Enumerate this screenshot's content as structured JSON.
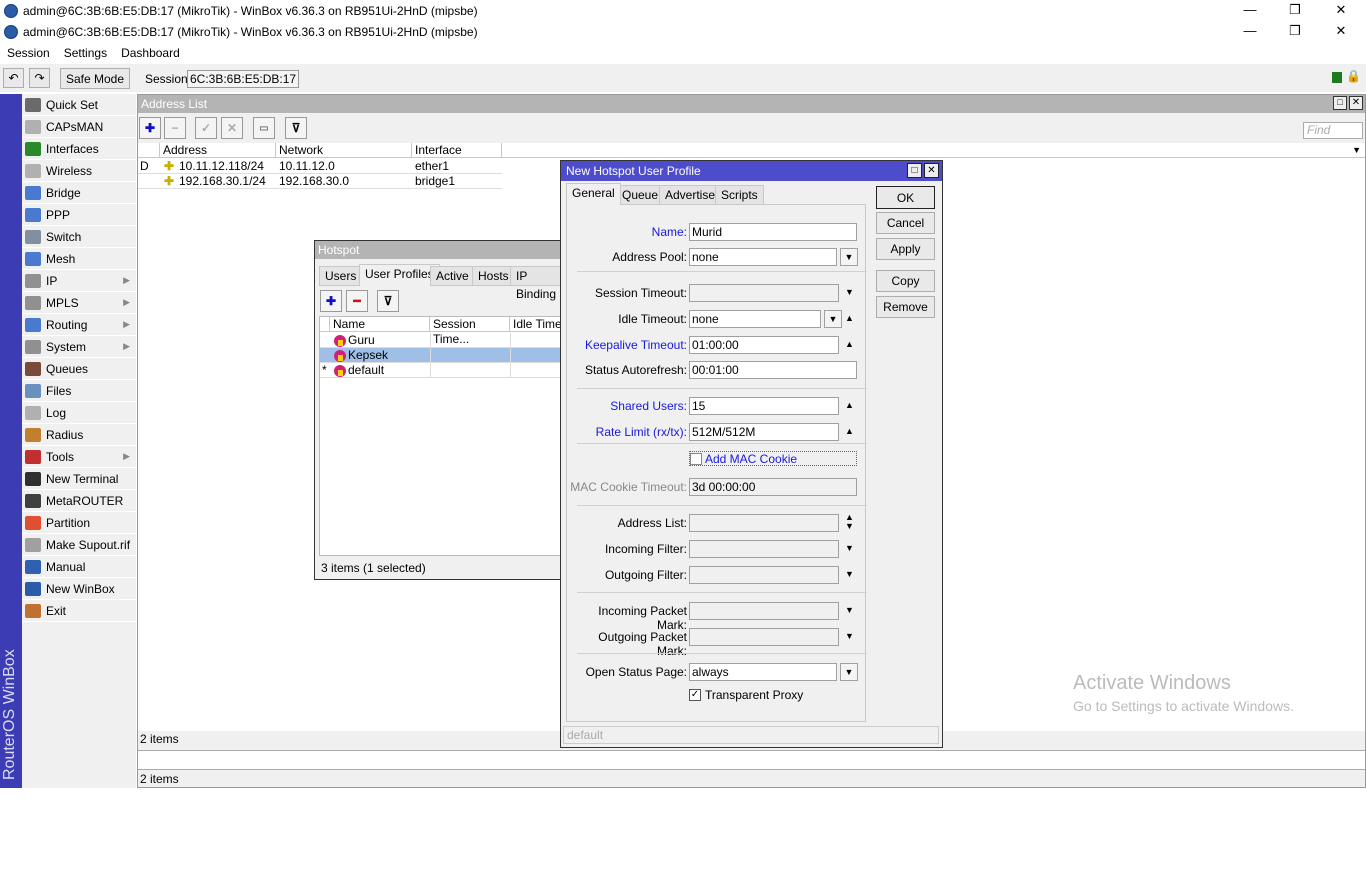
{
  "window_titles": [
    "admin@6C:3B:6B:E5:DB:17 (MikroTik) - WinBox v6.36.3 on RB951Ui-2HnD (mipsbe)",
    "admin@6C:3B:6B:E5:DB:17 (MikroTik) - WinBox v6.36.3 on RB951Ui-2HnD (mipsbe)"
  ],
  "menu": [
    "Session",
    "Settings",
    "Dashboard"
  ],
  "toolbar": {
    "safe_mode": "Safe Mode",
    "session_label": "Session:",
    "session_value": "6C:3B:6B:E5:DB:17"
  },
  "side_brand": "RouterOS WinBox",
  "nav": [
    {
      "label": "Quick Set",
      "color": "#6a6a6a"
    },
    {
      "label": "CAPsMAN",
      "color": "#b0b0b0"
    },
    {
      "label": "Interfaces",
      "color": "#2a8a2a"
    },
    {
      "label": "Wireless",
      "color": "#b0b0b0"
    },
    {
      "label": "Bridge",
      "color": "#4a7ad0"
    },
    {
      "label": "PPP",
      "color": "#4a7ad0"
    },
    {
      "label": "Switch",
      "color": "#8090a0"
    },
    {
      "label": "Mesh",
      "color": "#4a7ad0"
    },
    {
      "label": "IP",
      "color": "#909090",
      "sub": "▶"
    },
    {
      "label": "MPLS",
      "color": "#909090",
      "sub": "▶"
    },
    {
      "label": "Routing",
      "color": "#4a7ad0",
      "sub": "▶"
    },
    {
      "label": "System",
      "color": "#909090",
      "sub": "▶"
    },
    {
      "label": "Queues",
      "color": "#7a4a3a"
    },
    {
      "label": "Files",
      "color": "#6a90c0"
    },
    {
      "label": "Log",
      "color": "#b0b0b0"
    },
    {
      "label": "Radius",
      "color": "#c08030"
    },
    {
      "label": "Tools",
      "color": "#c03030",
      "sub": "▶"
    },
    {
      "label": "New Terminal",
      "color": "#303030"
    },
    {
      "label": "MetaROUTER",
      "color": "#404040"
    },
    {
      "label": "Partition",
      "color": "#e05030"
    },
    {
      "label": "Make Supout.rif",
      "color": "#a0a0a0"
    },
    {
      "label": "Manual",
      "color": "#3060b0"
    },
    {
      "label": "New WinBox",
      "color": "#2a5ca8"
    },
    {
      "label": "Exit",
      "color": "#c07030"
    }
  ],
  "address_list": {
    "title": "Address List",
    "find_placeholder": "Find",
    "columns": [
      "Address",
      "Network",
      "Interface"
    ],
    "rows": [
      {
        "flag": "D",
        "address": "10.11.12.118/24",
        "network": "10.11.12.0",
        "interface": "ether1"
      },
      {
        "flag": "",
        "address": "192.168.30.1/24",
        "network": "192.168.30.0",
        "interface": "bridge1"
      }
    ],
    "status": "2 items",
    "status2": "2 items"
  },
  "hotspot": {
    "title": "Hotspot",
    "tabs": [
      "Users",
      "User Profiles",
      "Active",
      "Hosts",
      "IP Binding"
    ],
    "columns": [
      "Name",
      "Session Time...",
      "Idle Timeo"
    ],
    "rows": [
      {
        "mark": "",
        "name": "Guru"
      },
      {
        "mark": "",
        "name": "Kepsek",
        "selected": true
      },
      {
        "mark": "*",
        "name": "default"
      }
    ],
    "status": "3 items (1 selected)"
  },
  "dialog": {
    "title": "New Hotspot User Profile",
    "tabs": [
      "General",
      "Queue",
      "Advertise",
      "Scripts"
    ],
    "buttons": [
      "OK",
      "Cancel",
      "Apply",
      "Copy",
      "Remove"
    ],
    "fields": {
      "name": {
        "label": "Name:",
        "value": "Murid"
      },
      "address_pool": {
        "label": "Address Pool:",
        "value": "none"
      },
      "session_timeout": {
        "label": "Session Timeout:",
        "value": ""
      },
      "idle_timeout": {
        "label": "Idle Timeout:",
        "value": "none"
      },
      "keepalive_timeout": {
        "label": "Keepalive Timeout:",
        "value": "01:00:00"
      },
      "status_autorefresh": {
        "label": "Status Autorefresh:",
        "value": "00:01:00"
      },
      "shared_users": {
        "label": "Shared Users:",
        "value": "15"
      },
      "rate_limit": {
        "label": "Rate Limit (rx/tx):",
        "value": "512M/512M"
      },
      "add_mac_cookie": {
        "label": "Add MAC Cookie",
        "checked": false
      },
      "mac_cookie_timeout": {
        "label": "MAC Cookie Timeout:",
        "value": "3d 00:00:00"
      },
      "address_list": {
        "label": "Address List:",
        "value": ""
      },
      "incoming_filter": {
        "label": "Incoming Filter:",
        "value": ""
      },
      "outgoing_filter": {
        "label": "Outgoing Filter:",
        "value": ""
      },
      "incoming_packet_mark": {
        "label": "Incoming Packet Mark:",
        "value": ""
      },
      "outgoing_packet_mark": {
        "label": "Outgoing Packet Mark:",
        "value": ""
      },
      "open_status_page": {
        "label": "Open Status Page:",
        "value": "always"
      },
      "transparent_proxy": {
        "label": "Transparent Proxy",
        "checked": true
      }
    },
    "status": "default"
  },
  "watermark": {
    "title": "Activate Windows",
    "subtitle": "Go to Settings to activate Windows."
  }
}
